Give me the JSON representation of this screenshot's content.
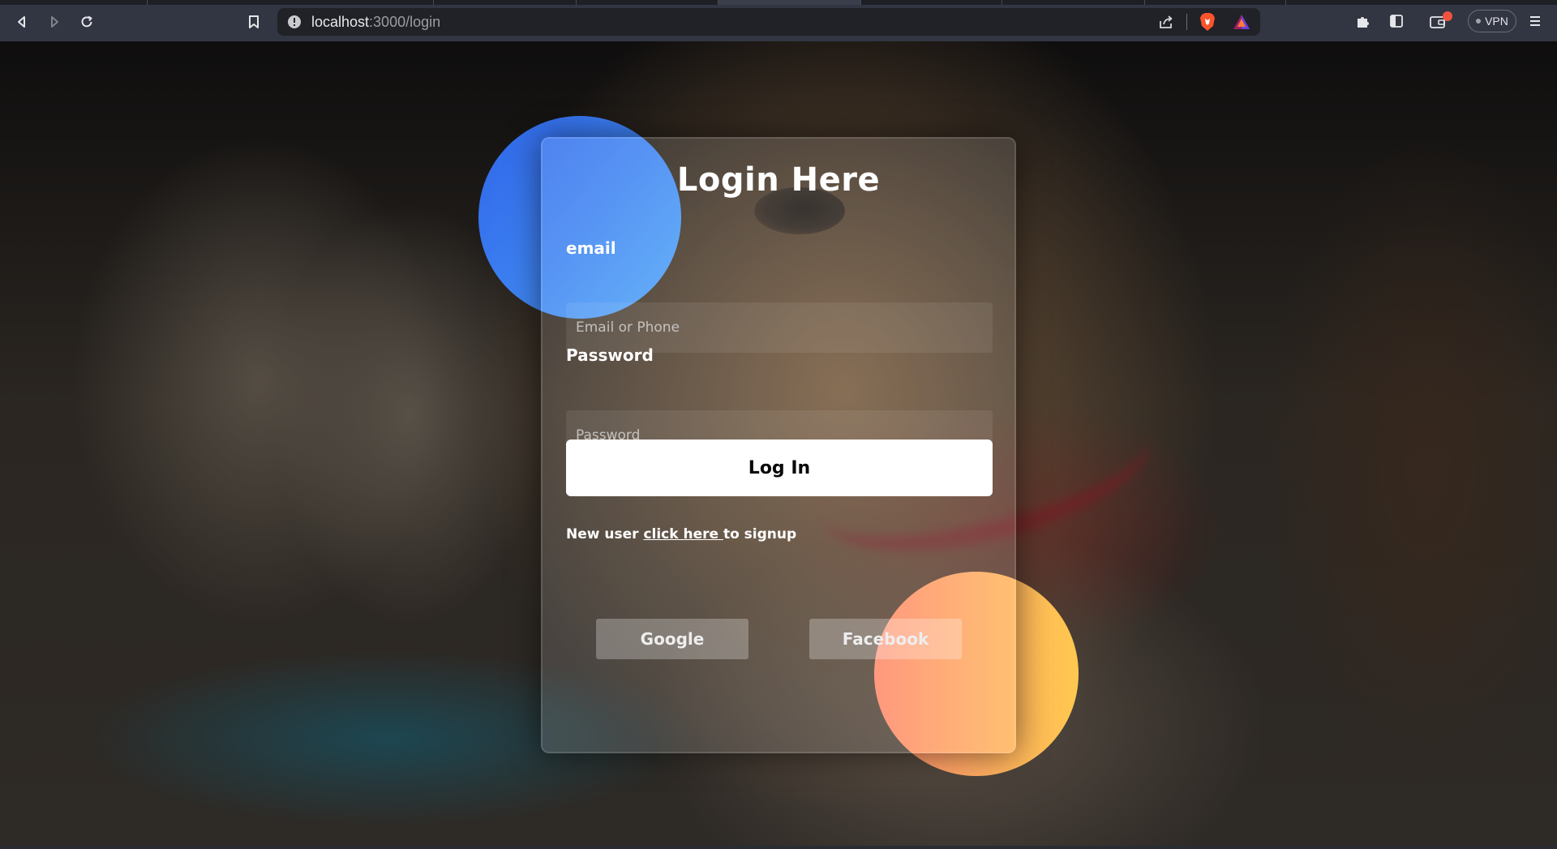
{
  "browser": {
    "url_host": "localhost",
    "url_path": ":3000/login",
    "vpn_label": "VPN",
    "icons": {
      "back": "back-arrow-icon",
      "forward": "forward-arrow-icon",
      "reload": "reload-icon",
      "bookmark": "bookmark-icon",
      "site_info": "info-icon",
      "share": "share-icon",
      "brave": "brave-shield-icon",
      "rewards": "brave-rewards-icon",
      "extensions": "puzzle-icon",
      "sidebar": "sidebar-icon",
      "wallet": "wallet-icon",
      "menu": "hamburger-menu-icon"
    }
  },
  "login": {
    "title": "Login Here",
    "email_label": "email",
    "email_placeholder": "Email or Phone",
    "password_label": "Password",
    "password_placeholder": "Password",
    "login_button": "Log In",
    "signup_prefix": "New user ",
    "signup_link": "click here ",
    "signup_suffix": "to signup",
    "google_button": "Google",
    "facebook_button": "Facebook"
  },
  "colors": {
    "blob_blue": "#3d82f2",
    "blob_orange": "#ffab62",
    "button_bg": "#ffffff"
  }
}
